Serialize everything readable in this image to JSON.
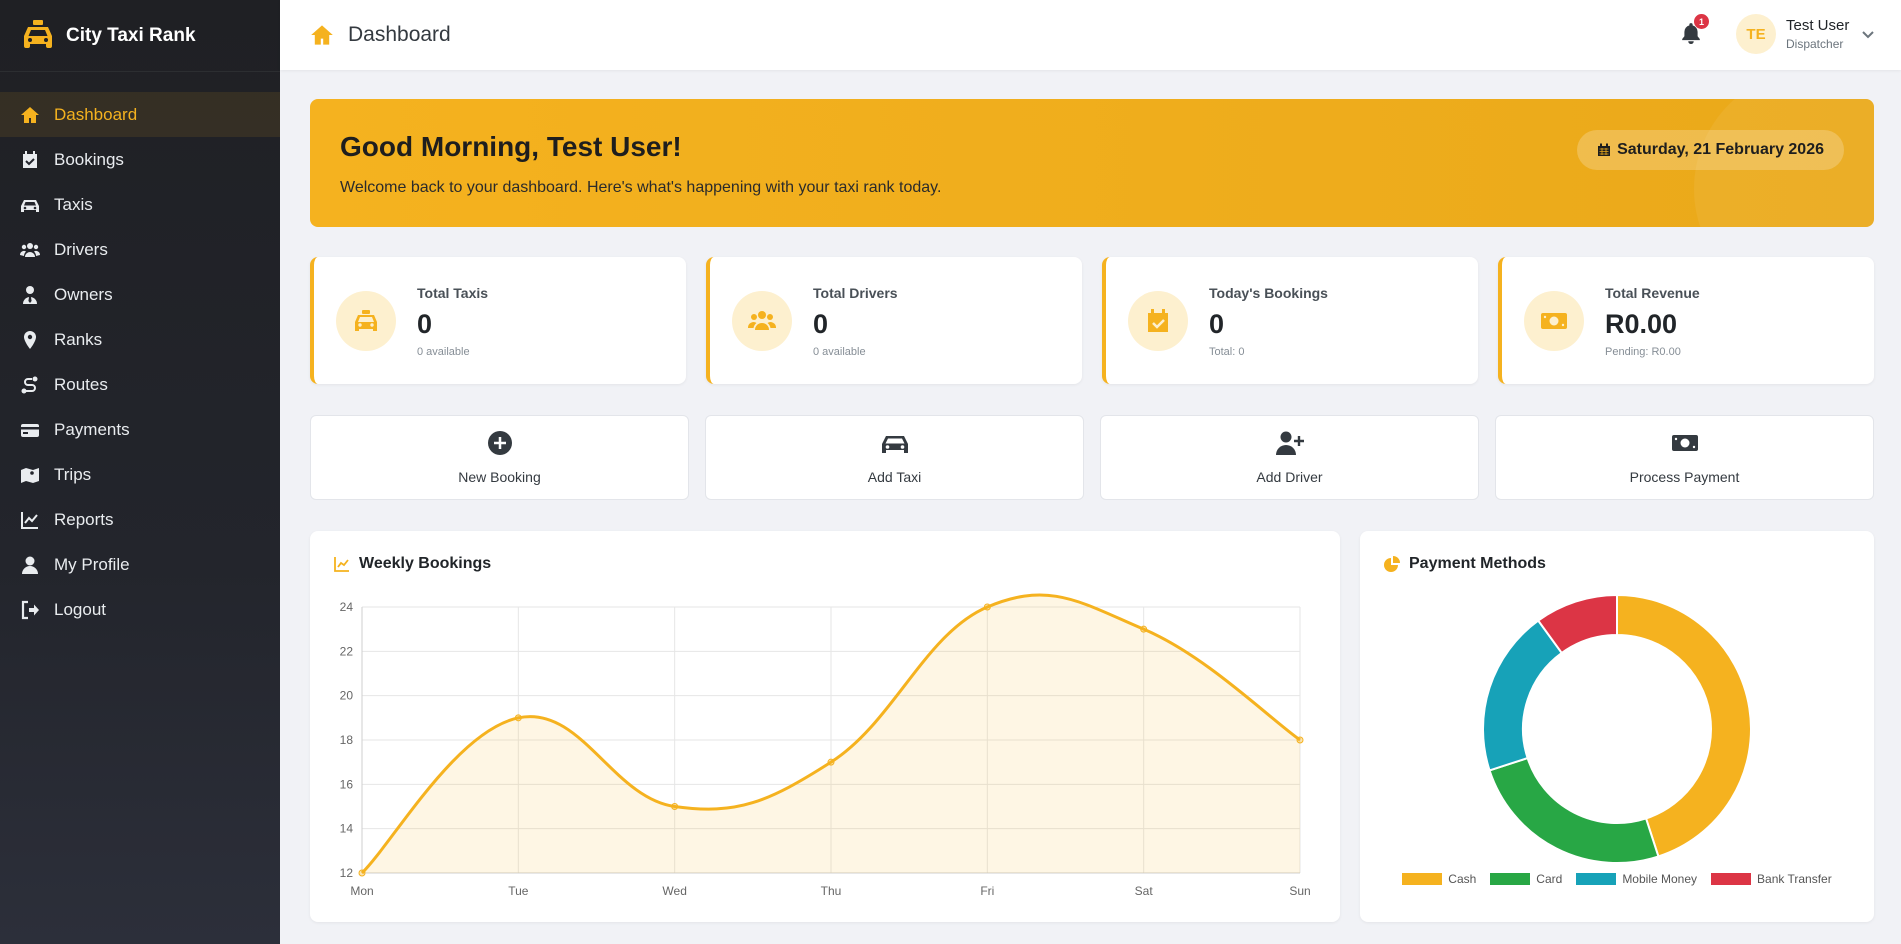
{
  "app": {
    "name": "City Taxi Rank"
  },
  "sidebar": {
    "items": [
      {
        "label": "Dashboard",
        "icon": "home-icon",
        "active": true
      },
      {
        "label": "Bookings",
        "icon": "calendar-check-icon"
      },
      {
        "label": "Taxis",
        "icon": "car-icon"
      },
      {
        "label": "Drivers",
        "icon": "users-icon"
      },
      {
        "label": "Owners",
        "icon": "user-tie-icon"
      },
      {
        "label": "Ranks",
        "icon": "map-marker-icon"
      },
      {
        "label": "Routes",
        "icon": "route-icon"
      },
      {
        "label": "Payments",
        "icon": "credit-card-icon"
      },
      {
        "label": "Trips",
        "icon": "map-icon"
      },
      {
        "label": "Reports",
        "icon": "line-chart-icon"
      },
      {
        "label": "My Profile",
        "icon": "user-icon"
      },
      {
        "label": "Logout",
        "icon": "logout-icon"
      }
    ]
  },
  "topbar": {
    "title": "Dashboard",
    "notifications_count": "1",
    "user": {
      "initials": "TE",
      "name": "Test User",
      "role": "Dispatcher"
    }
  },
  "banner": {
    "greeting": "Good Morning, Test User!",
    "message": "Welcome back to your dashboard. Here's what's happening with your taxi rank today.",
    "date": "Saturday, 21 February 2026"
  },
  "stats": [
    {
      "label": "Total Taxis",
      "value": "0",
      "sub": "0 available",
      "icon": "taxi-icon"
    },
    {
      "label": "Total Drivers",
      "value": "0",
      "sub": "0 available",
      "icon": "users-icon"
    },
    {
      "label": "Today's Bookings",
      "value": "0",
      "sub": "Total: 0",
      "icon": "calendar-check-icon"
    },
    {
      "label": "Total Revenue",
      "value": "R0.00",
      "sub": "Pending: R0.00",
      "icon": "money-icon"
    }
  ],
  "quick_actions": [
    {
      "label": "New Booking",
      "icon": "plus-circle-icon"
    },
    {
      "label": "Add Taxi",
      "icon": "car-icon"
    },
    {
      "label": "Add Driver",
      "icon": "user-plus-icon"
    },
    {
      "label": "Process Payment",
      "icon": "money-icon"
    }
  ],
  "colors": {
    "accent": "#f5b21f",
    "sidebar": "#1f2024"
  },
  "chart_data": [
    {
      "type": "line",
      "title": "Weekly Bookings",
      "categories": [
        "Mon",
        "Tue",
        "Wed",
        "Thu",
        "Fri",
        "Sat",
        "Sun"
      ],
      "series": [
        {
          "values": [
            12,
            19,
            15,
            17,
            24,
            23,
            18
          ]
        }
      ],
      "ylim": [
        12,
        24
      ],
      "yticks": [
        12,
        14,
        16,
        18,
        20,
        22,
        24
      ],
      "grid": true,
      "fill": true
    },
    {
      "type": "pie",
      "title": "Payment Methods",
      "labels": [
        "Cash",
        "Card",
        "Mobile Money",
        "Bank Transfer"
      ],
      "values": [
        45,
        25,
        20,
        10
      ],
      "colors": [
        "#f5b21f",
        "#28a745",
        "#17a2b8",
        "#dc3545"
      ],
      "legend": "bottom",
      "donut": true
    }
  ]
}
